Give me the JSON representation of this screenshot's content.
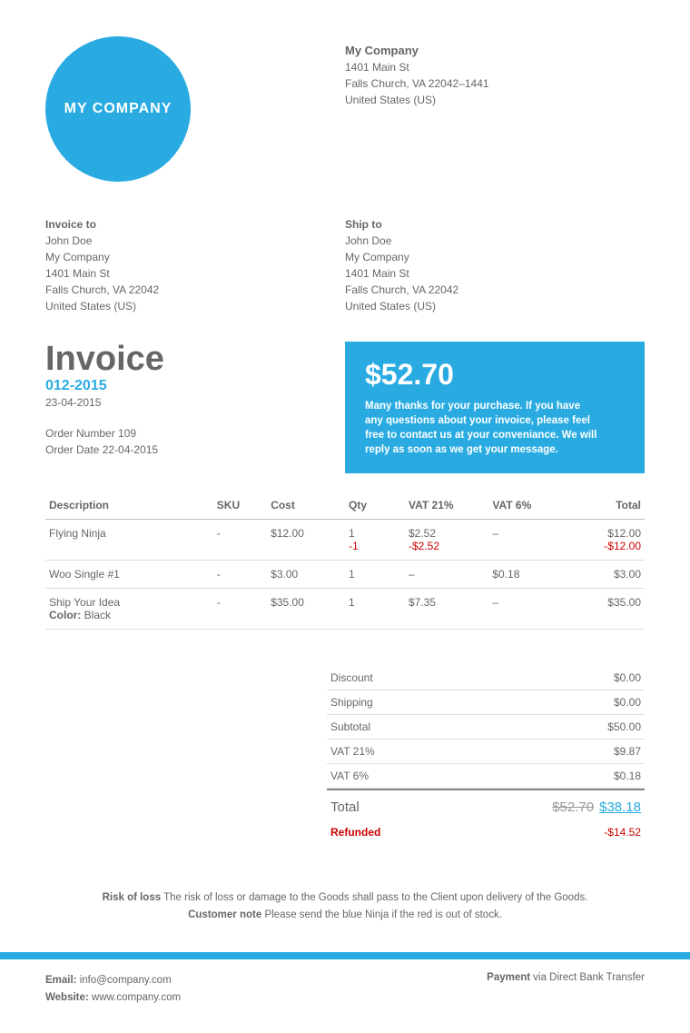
{
  "logo": "MY COMPANY",
  "company": {
    "name": "My Company",
    "addr1": "1401 Main St",
    "addr2": "Falls Church, VA 22042–1441",
    "country": "United States (US)"
  },
  "invoice_to": {
    "label": "Invoice to",
    "name": "John Doe",
    "company": "My Company",
    "addr1": "1401 Main St",
    "addr2": "Falls Church, VA 22042",
    "country": "United States (US)"
  },
  "ship_to": {
    "label": "Ship to",
    "name": "John Doe",
    "company": "My Company",
    "addr1": "1401 Main St",
    "addr2": "Falls Church, VA 22042",
    "country": "United States (US)"
  },
  "invoice": {
    "title": "Invoice",
    "number": "012-2015",
    "date": "23-04-2015",
    "order_number": "Order Number 109",
    "order_date": "Order Date 22-04-2015",
    "amount": "$52.70",
    "thanks": "Many thanks for your purchase. If you have any questions about your invoice, please feel free to contact us at your conveniance. We will reply as soon as we get your message."
  },
  "headers": {
    "desc": "Description",
    "sku": "SKU",
    "cost": "Cost",
    "qty": "Qty",
    "vat21": "VAT 21%",
    "vat6": "VAT 6%",
    "total": "Total"
  },
  "items": [
    {
      "desc": "Flying Ninja",
      "meta": "",
      "sku": "-",
      "cost": "$12.00",
      "qty": "1",
      "qty_neg": "-1",
      "vat21": "$2.52",
      "vat21_neg": "-$2.52",
      "vat6": "–",
      "total": "$12.00",
      "total_neg": "-$12.00"
    },
    {
      "desc": "Woo Single #1",
      "meta": "",
      "sku": "-",
      "cost": "$3.00",
      "qty": "1",
      "qty_neg": "",
      "vat21": "–",
      "vat21_neg": "",
      "vat6": "$0.18",
      "total": "$3.00",
      "total_neg": ""
    },
    {
      "desc": "Ship Your Idea",
      "meta": "Color:",
      "meta_val": " Black",
      "sku": "-",
      "cost": "$35.00",
      "qty": "1",
      "qty_neg": "",
      "vat21": "$7.35",
      "vat21_neg": "",
      "vat6": "–",
      "total": "$35.00",
      "total_neg": ""
    }
  ],
  "summary": {
    "discount_l": "Discount",
    "discount_v": "$0.00",
    "shipping_l": "Shipping",
    "shipping_v": "$0.00",
    "subtotal_l": "Subtotal",
    "subtotal_v": "$50.00",
    "vat21_l": "VAT 21%",
    "vat21_v": "$9.87",
    "vat6_l": "VAT 6%",
    "vat6_v": "$0.18",
    "total_l": "Total",
    "total_old": "$52.70",
    "total_new": "$38.18",
    "refund_l": "Refunded",
    "refund_v": "-$14.52"
  },
  "notes": {
    "risk_l": "Risk of loss",
    "risk_t": " The risk of loss or damage to the Goods shall pass to the Client upon delivery of the Goods.",
    "cust_l": "Customer note",
    "cust_t": " Please send the blue Ninja if the red is out of stock."
  },
  "footer": {
    "email_l": "Email:",
    "email_v": " info@company.com",
    "web_l": "Website:",
    "web_v": " www.company.com",
    "pay_l": "Payment",
    "pay_v": " via Direct Bank Transfer"
  }
}
